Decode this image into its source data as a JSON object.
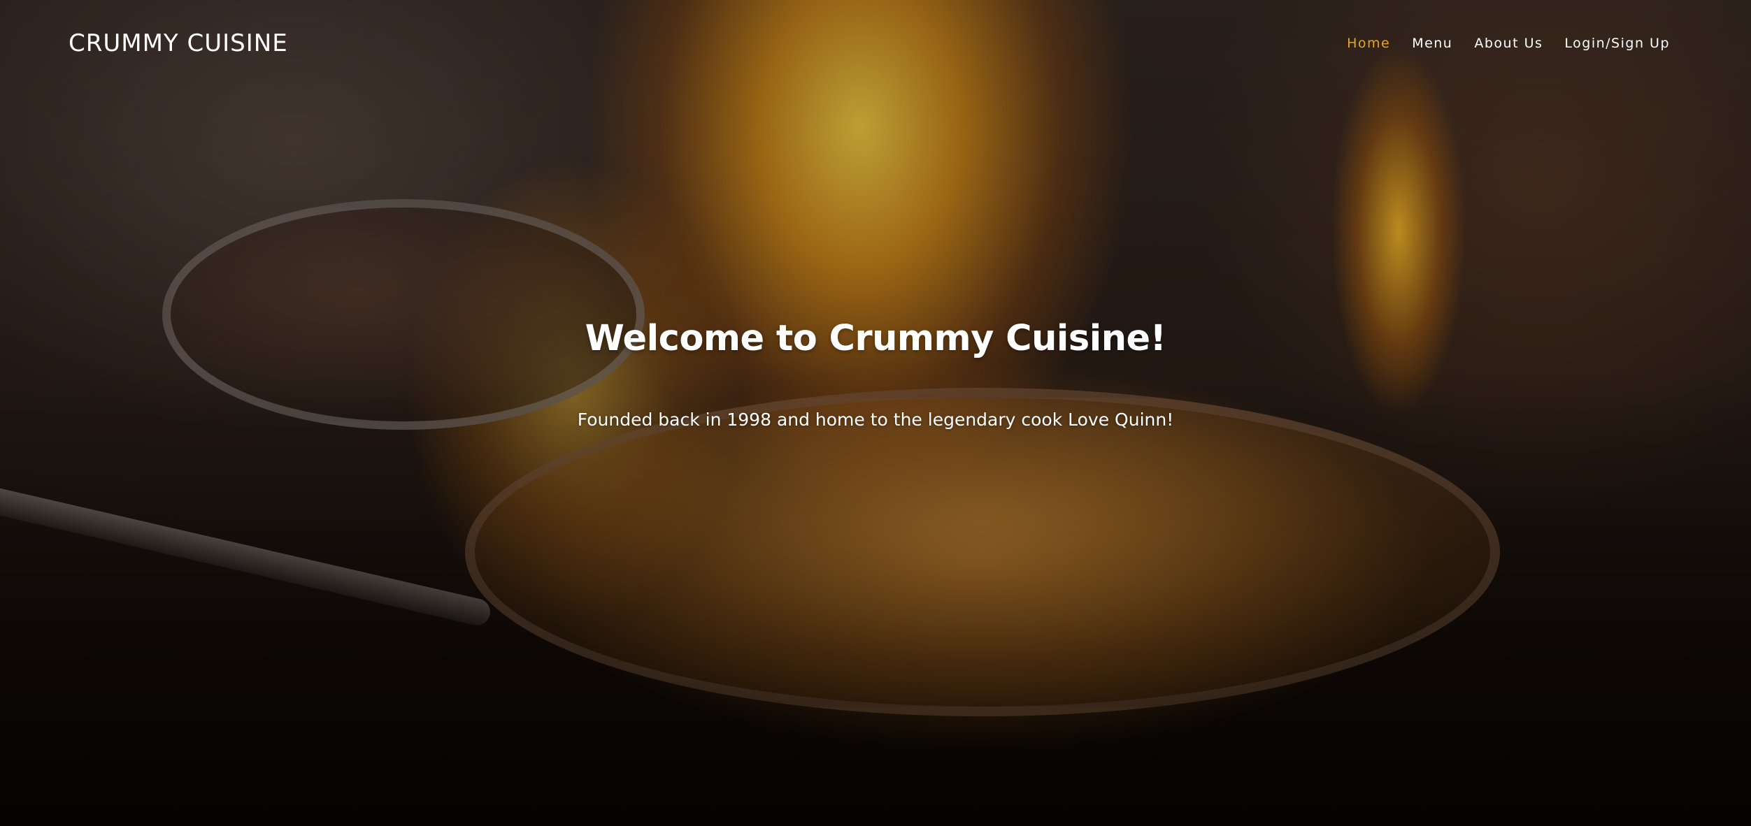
{
  "header": {
    "brand": "CRUMMY CUISINE",
    "nav": [
      {
        "label": "Home",
        "active": true
      },
      {
        "label": "Menu",
        "active": false
      },
      {
        "label": "About Us",
        "active": false
      },
      {
        "label": "Login/Sign Up",
        "active": false
      }
    ]
  },
  "hero": {
    "title": "Welcome to Crummy Cuisine!",
    "subtitle": "Founded back in 1998 and home to the legendary cook Love Quinn!",
    "background_image": "flambe-pan-kitchen-photo"
  },
  "colors": {
    "nav_active": "#e7a41e",
    "text": "#ffffff"
  }
}
